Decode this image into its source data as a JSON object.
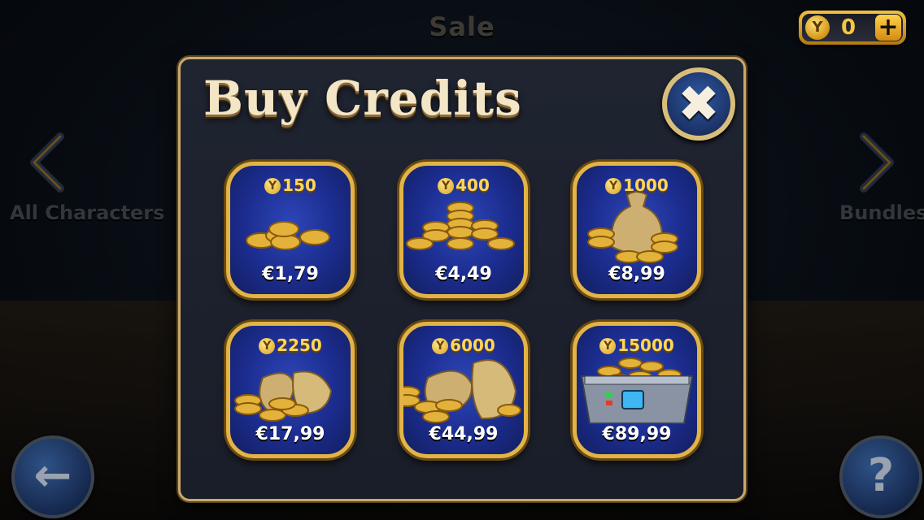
{
  "background": {
    "title": "Sale",
    "left_label": "All Characters",
    "right_label": "Bundles"
  },
  "wallet": {
    "coin_icon": "Y",
    "amount": "0",
    "plus": "+"
  },
  "dialog": {
    "title": "Buy Credits",
    "close_glyph": "✖"
  },
  "packs": [
    {
      "credits": "150",
      "price": "€1,79",
      "art": "few-coins"
    },
    {
      "credits": "400",
      "price": "€4,49",
      "art": "coin-stacks"
    },
    {
      "credits": "1000",
      "price": "€8,99",
      "art": "coin-sack"
    },
    {
      "credits": "2250",
      "price": "€17,99",
      "art": "two-sacks"
    },
    {
      "credits": "6000",
      "price": "€44,99",
      "art": "big-sacks"
    },
    {
      "credits": "15000",
      "price": "€89,99",
      "art": "treasure-crate"
    }
  ],
  "nav": {
    "back_glyph": "←",
    "help_glyph": "?"
  },
  "colors": {
    "gold": "#e2b447",
    "tile_blue": "#1b2c8e",
    "panel": "#1f2431"
  }
}
